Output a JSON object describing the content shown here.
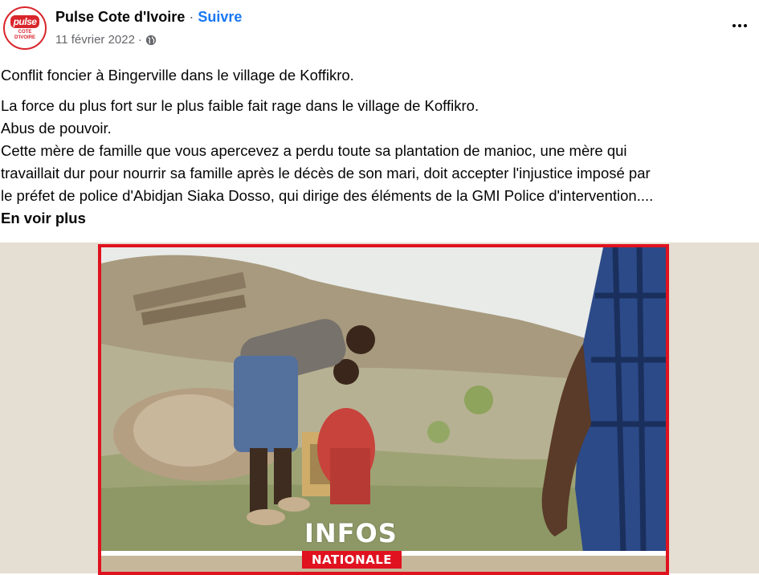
{
  "post": {
    "author": "Pulse Cote d'Ivoire",
    "separator": " · ",
    "follow_label": "Suivre",
    "date": "11 février 2022",
    "date_sep": " · ",
    "avatar": {
      "logo_top": "pulse",
      "logo_bottom": "COTE D'IVOIRE",
      "brand_color": "#d9252c"
    },
    "privacy_icon": "globe-icon",
    "more_icon": "more-options-icon"
  },
  "body": {
    "line1": "Conflit foncier à Bingerville dans le village de Koffikro.",
    "line2": "La force du plus fort sur le plus faible fait rage dans le village de Koffikro.",
    "line3": "Abus de pouvoir.",
    "line4": "Cette mère de famille que vous apercevez a perdu toute sa plantation de manioc, une mère qui",
    "line5": "travaillait dur pour nourrir sa famille après le décès de son mari, doit accepter l'injustice imposé par",
    "line6": "le préfet de police d'Abidjan Siaka Dosso, qui dirige des éléments de la GMI Police d'intervention....",
    "see_more": "En voir plus"
  },
  "media": {
    "caption_big": "INFOS",
    "caption_tag": "NATIONALE",
    "frame_color": "#e0121f"
  }
}
